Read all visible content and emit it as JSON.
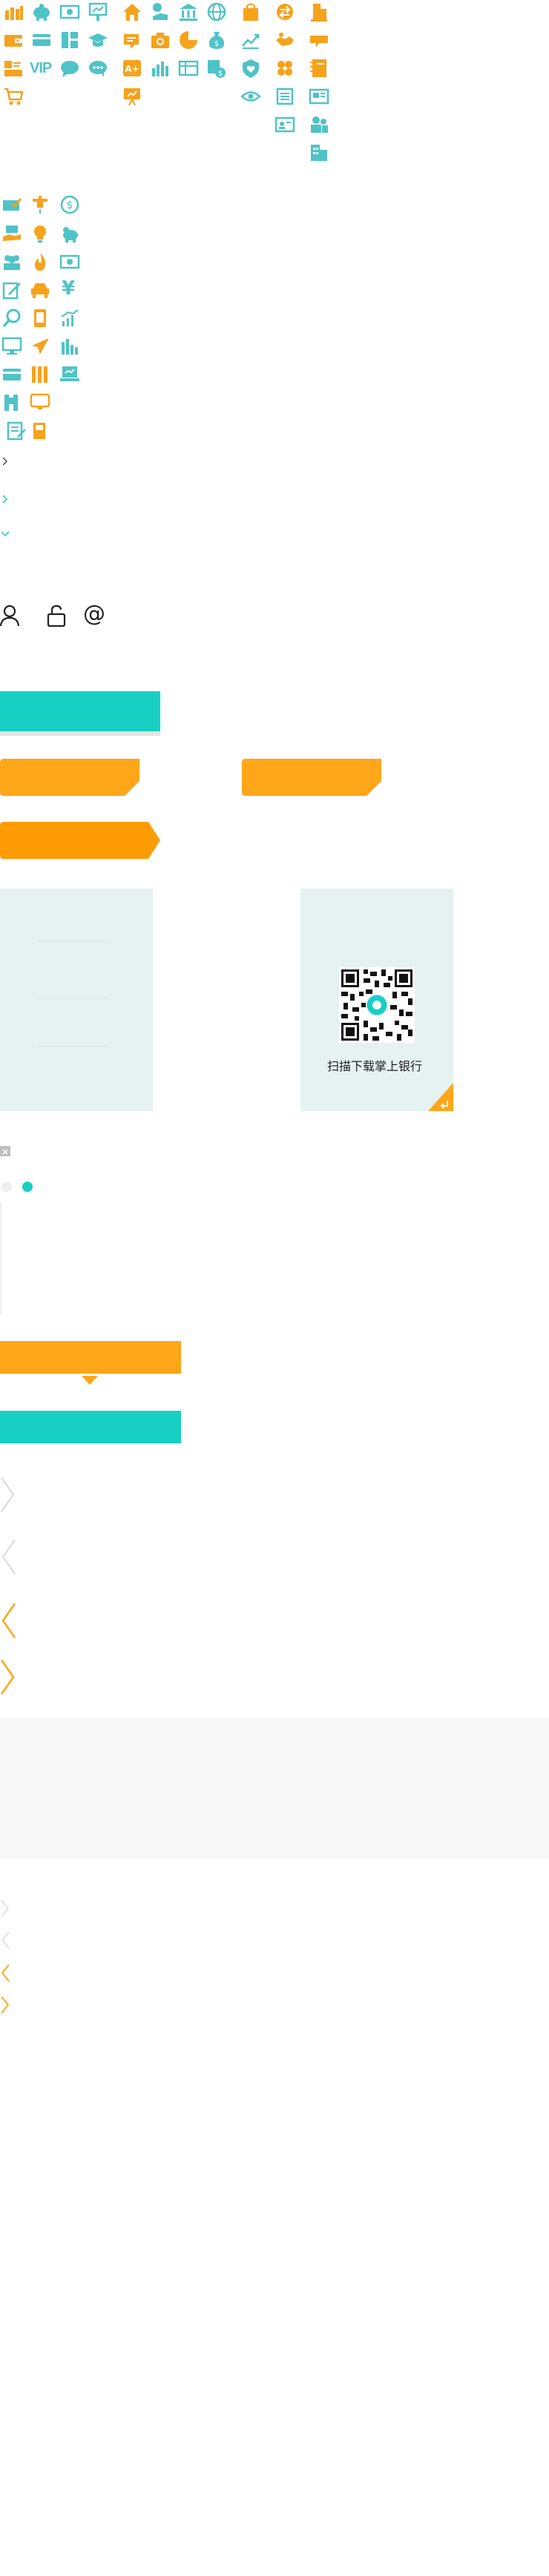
{
  "qr": {
    "caption": "扫描下载掌上银行"
  },
  "labels": {
    "vip": "VIP",
    "yen": "¥",
    "dollar": "$",
    "at": "@",
    "a_plus": "A+"
  },
  "colors": {
    "orange": "#f7a21b",
    "teal": "#4fc3c7",
    "button_teal": "#17cfc3",
    "button_orange": "#ffa619",
    "panel": "#e5f2f1",
    "gray_band": "#f8f8f8"
  },
  "icons": {
    "sprite_row1": [
      "coins-icon",
      "piggy-bank-icon",
      "cash-icon",
      "chart-board-icon",
      "home-icon",
      "hand-coin-icon",
      "bank-building-icon",
      "globe-icon",
      "shopping-bag-icon",
      "exchange-icon",
      "building-icon"
    ],
    "sprite_row2": [
      "wallet-icon",
      "card-icon",
      "grid-icon",
      "graduation-cap-icon",
      "gift-icon",
      "camera-icon",
      "pie-chart-icon",
      "money-bag-icon",
      "trend-icon",
      "handshake-icon",
      "megaphone-icon"
    ],
    "sprite_row3": [
      "user-card-icon",
      "vip-icon",
      "chat-icon",
      "message-icon",
      "a-plus-icon",
      "bar-chart-icon",
      "table-icon",
      "dollar-stack-icon",
      "shield-heart-icon",
      "clover-icon",
      "notebook-icon"
    ],
    "sprite_row4": [
      "cart-icon",
      "presentation-icon",
      "eye-icon",
      "list-icon",
      "card-2-icon"
    ],
    "list_icons": [
      "check-card-icon",
      "faucet-icon",
      "dollar-circle-icon",
      "hand-money-icon",
      "bulb-icon",
      "piggy-icon",
      "group-icon",
      "fire-icon",
      "cash-2-icon",
      "edit-icon",
      "car-icon",
      "yen-icon",
      "search-icon",
      "phone-icon",
      "growth-icon",
      "monitor-icon",
      "plane-icon",
      "bars-icon",
      "card-3-icon",
      "books-icon",
      "laptop-icon",
      "castle-icon",
      "screen-icon",
      "notepad-icon",
      "fuel-icon"
    ],
    "form_icons": [
      "user-icon",
      "lock-icon",
      "at-icon"
    ]
  }
}
